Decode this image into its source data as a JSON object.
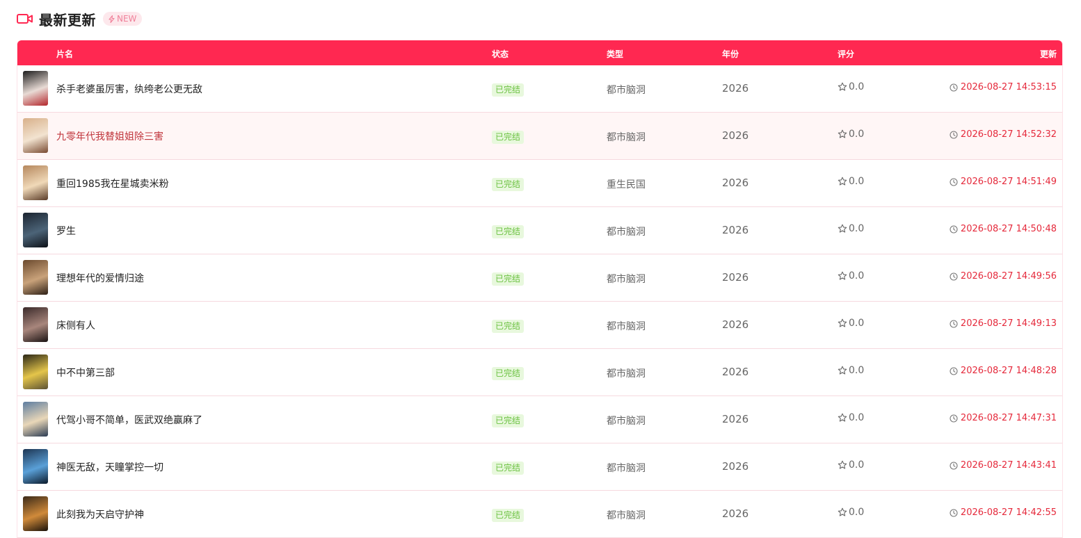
{
  "section": {
    "title": "最新更新",
    "badge": "NEW",
    "accent": "#ff2851"
  },
  "columns": {
    "name": "片名",
    "status": "状态",
    "genre": "类型",
    "year": "年份",
    "rating": "评分",
    "updated": "更新"
  },
  "rows": [
    {
      "name": "杀手老婆虽厉害，纨绔老公更无敌",
      "status": "已完结",
      "genre": "都市脑洞",
      "year": "2026",
      "rating": "0.0",
      "updated": "2026-08-27 14:53:15",
      "poster_colors": [
        "#1d1d1d",
        "#e8dbd5",
        "#b3262b"
      ]
    },
    {
      "name": "九零年代我替姐姐除三害",
      "status": "已完结",
      "genre": "都市脑洞",
      "year": "2026",
      "rating": "0.0",
      "updated": "2026-08-27 14:52:32",
      "poster_colors": [
        "#d8b08a",
        "#f2e3d0",
        "#7a4b32"
      ]
    },
    {
      "name": "重回1985我在星城卖米粉",
      "status": "已完结",
      "genre": "重生民国",
      "year": "2026",
      "rating": "0.0",
      "updated": "2026-08-27 14:51:49",
      "poster_colors": [
        "#b5875d",
        "#f0d9b8",
        "#5a3b27"
      ]
    },
    {
      "name": "罗生",
      "status": "已完结",
      "genre": "都市脑洞",
      "year": "2026",
      "rating": "0.0",
      "updated": "2026-08-27 14:50:48",
      "poster_colors": [
        "#1b2430",
        "#4c6478",
        "#0d1117"
      ]
    },
    {
      "name": "理想年代的爱情归途",
      "status": "已完结",
      "genre": "都市脑洞",
      "year": "2026",
      "rating": "0.0",
      "updated": "2026-08-27 14:49:56",
      "poster_colors": [
        "#6b4a2e",
        "#c9a27a",
        "#2e2016"
      ]
    },
    {
      "name": "床侧有人",
      "status": "已完结",
      "genre": "都市脑洞",
      "year": "2026",
      "rating": "0.0",
      "updated": "2026-08-27 14:49:13",
      "poster_colors": [
        "#3a2a2a",
        "#a8867c",
        "#1a1212"
      ]
    },
    {
      "name": "中不中第三部",
      "status": "已完结",
      "genre": "都市脑洞",
      "year": "2026",
      "rating": "0.0",
      "updated": "2026-08-27 14:48:28",
      "poster_colors": [
        "#2a2616",
        "#e4c54a",
        "#5c5233"
      ]
    },
    {
      "name": "代驾小哥不简单，医武双绝赢麻了",
      "status": "已完结",
      "genre": "都市脑洞",
      "year": "2026",
      "rating": "0.0",
      "updated": "2026-08-27 14:47:31",
      "poster_colors": [
        "#5d7da0",
        "#e9d7b8",
        "#2a3a52"
      ]
    },
    {
      "name": "神医无敌，天瞳掌控一切",
      "status": "已完结",
      "genre": "都市脑洞",
      "year": "2026",
      "rating": "0.0",
      "updated": "2026-08-27 14:43:41",
      "poster_colors": [
        "#1d3552",
        "#5aa0d8",
        "#0c1a2b"
      ]
    },
    {
      "name": "此刻我为天启守护神",
      "status": "已完结",
      "genre": "都市脑洞",
      "year": "2026",
      "rating": "0.0",
      "updated": "2026-08-27 14:42:55",
      "poster_colors": [
        "#3a2a18",
        "#d08a3a",
        "#1a120a"
      ]
    }
  ]
}
